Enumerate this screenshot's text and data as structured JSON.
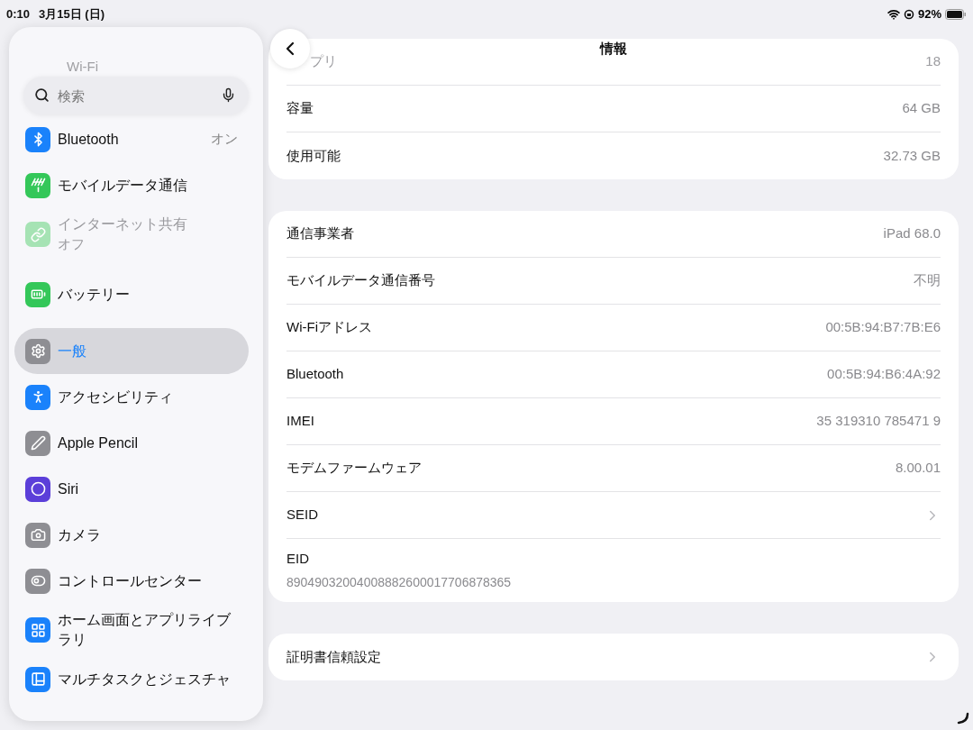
{
  "status_bar": {
    "time": "0:10",
    "date": "3月15日 (日)",
    "battery": "92%"
  },
  "search": {
    "placeholder": "検索"
  },
  "sidebar": {
    "faded_item": {
      "label": "Wi-Fi"
    },
    "sections": [
      {
        "items": [
          {
            "label": "Bluetooth",
            "value": "オン",
            "color": "#1a82fb",
            "disabled": false,
            "selected": false
          },
          {
            "label": "モバイルデータ通信",
            "color": "#34c759",
            "disabled": false,
            "selected": false
          },
          {
            "label": "インターネット共有",
            "sub": "オフ",
            "color": "#a6e3b4",
            "disabled": true,
            "selected": false
          }
        ]
      },
      {
        "items": [
          {
            "label": "バッテリー",
            "color": "#34c759",
            "disabled": false,
            "selected": false
          }
        ]
      },
      {
        "items": [
          {
            "label": "一般",
            "color": "#8e8e93",
            "disabled": false,
            "selected": true
          },
          {
            "label": "アクセシビリティ",
            "color": "#1a82fb",
            "disabled": false,
            "selected": false
          },
          {
            "label": "Apple Pencil",
            "color": "#8e8e93",
            "disabled": false,
            "selected": false
          },
          {
            "label": "Siri",
            "color": "#5b3fd9",
            "disabled": false,
            "selected": false
          },
          {
            "label": "カメラ",
            "color": "#8e8e93",
            "disabled": false,
            "selected": false
          },
          {
            "label": "コントロールセンター",
            "color": "#8e8e93",
            "disabled": false,
            "selected": false
          },
          {
            "label": "ホーム画面とアプリライブラリ",
            "color": "#1a82fb",
            "disabled": false,
            "selected": false
          },
          {
            "label": "マルチタスクとジェスチャ",
            "color": "#1a82fb",
            "disabled": false,
            "selected": false
          }
        ]
      }
    ]
  },
  "header": {
    "title": "情報"
  },
  "groups": [
    {
      "rows": [
        {
          "kind": "faded",
          "label": "プリ",
          "value": "18"
        },
        {
          "kind": "value",
          "label": "容量",
          "value": "64 GB"
        },
        {
          "kind": "value",
          "label": "使用可能",
          "value": "32.73 GB"
        }
      ]
    },
    {
      "rows": [
        {
          "kind": "value",
          "label": "通信事業者",
          "value": "iPad 68.0"
        },
        {
          "kind": "value",
          "label": "モバイルデータ通信番号",
          "value": "不明"
        },
        {
          "kind": "value",
          "label": "Wi-Fiアドレス",
          "value": "00:5B:94:B7:7B:E6"
        },
        {
          "kind": "value",
          "label": "Bluetooth",
          "value": "00:5B:94:B6:4A:92"
        },
        {
          "kind": "value",
          "label": "IMEI",
          "value": "35 319310 785471 9"
        },
        {
          "kind": "value",
          "label": "モデムファームウェア",
          "value": "8.00.01"
        },
        {
          "kind": "link",
          "label": "SEID"
        },
        {
          "kind": "stacked",
          "label": "EID",
          "value": "89049032004008882600017706878365"
        }
      ]
    },
    {
      "rows": [
        {
          "kind": "link",
          "label": "証明書信頼設定"
        }
      ]
    }
  ]
}
